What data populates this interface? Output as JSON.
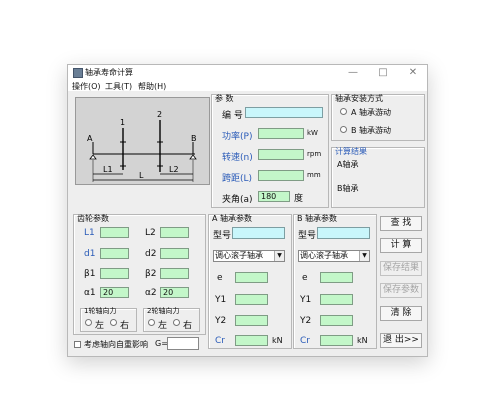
{
  "window": {
    "title": "轴承寿命计算",
    "controls": {
      "minimize": "—",
      "maximize": "□",
      "close": "✕"
    }
  },
  "menu": [
    "操作(O)",
    "工具(T)",
    "帮助(H)"
  ],
  "diagram": {
    "left_label": "A",
    "right_label": "B",
    "n1": "1",
    "n2": "2",
    "l1": "L1",
    "l2": "L2",
    "l": "L"
  },
  "params": {
    "title": "参  数",
    "number_label": "编  号",
    "number_value": "",
    "power_label": "功率(P)",
    "power_unit": "kW",
    "power_value": "",
    "speed_label": "转速(n)",
    "speed_unit": "rpm",
    "speed_value": "",
    "span_label": "跨距(L)",
    "span_unit": "mm",
    "span_value": "",
    "angle_label": "夹角(a)",
    "angle_value": "180",
    "angle_unit": "度"
  },
  "install": {
    "title": "轴承安装方式",
    "option_a": "A 轴承游动",
    "option_b": "B 轴承游动"
  },
  "result": {
    "title": "计算结果",
    "a_label": "A轴承",
    "b_label": "B轴承"
  },
  "gear": {
    "title": "齿轮参数",
    "l1": "L1",
    "l2": "L2",
    "d1": "d1",
    "d2": "d2",
    "b1": "β1",
    "b2": "β2",
    "a1": "α1",
    "a2": "α2",
    "l1_value": "",
    "l2_value": "",
    "d1_value": "",
    "d2_value": "",
    "b1_value": "",
    "b2_value": "",
    "a1_value": "20",
    "a2_value": "20",
    "axial1_title": "1轮轴向力",
    "axial2_title": "2轮轴向力",
    "left": "左",
    "right": "右"
  },
  "bearing_a": {
    "title": "A 轴承参数",
    "model_label": "型号",
    "model_value": "",
    "type_value": "调心滚子轴承",
    "e_label": "e",
    "y1_label": "Y1",
    "y2_label": "Y2",
    "cr_label": "Cr",
    "cr_unit": "kN"
  },
  "bearing_b": {
    "title": "B 轴承参数",
    "model_label": "型号",
    "model_value": "",
    "type_value": "调心滚子轴承",
    "e_label": "e",
    "y1_label": "Y1",
    "y2_label": "Y2",
    "cr_label": "Cr",
    "cr_unit": "kN"
  },
  "buttons": {
    "search": "查  找",
    "calc": "计  算",
    "save_result": "保存结果",
    "save_param": "保存参数",
    "clear": "清  除",
    "exit": "退 出>>"
  },
  "bottom": {
    "self_weight_label": "考虑轴向自重影响",
    "g_label": "G=",
    "g_value": ""
  }
}
